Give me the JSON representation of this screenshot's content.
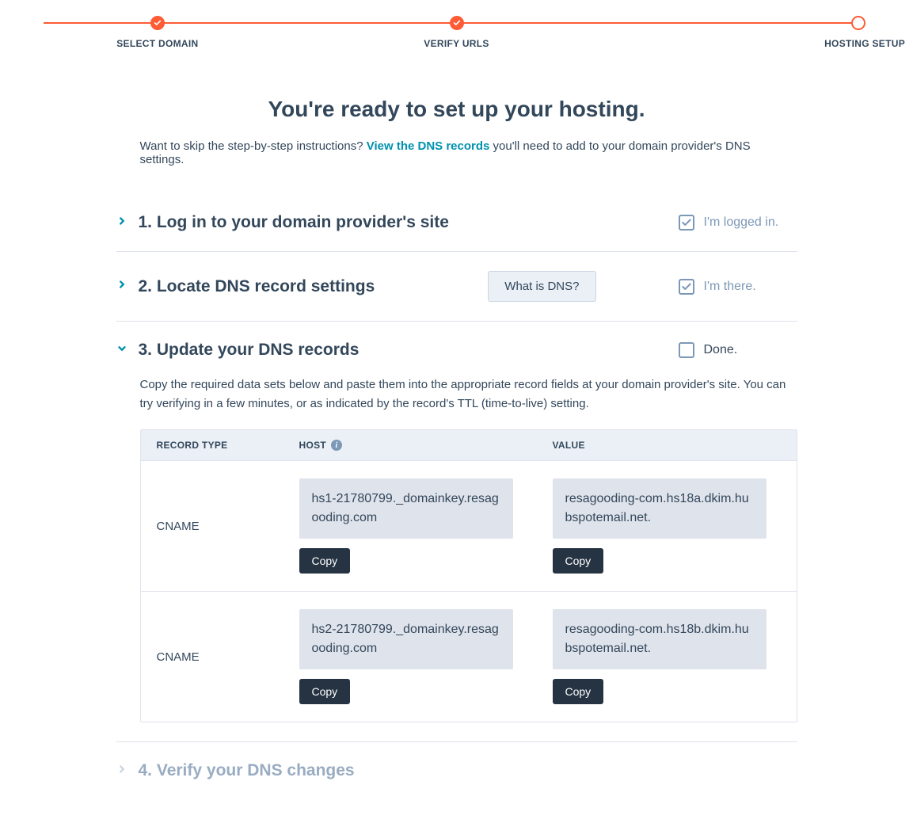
{
  "stepper": {
    "steps": [
      {
        "label": "SELECT DOMAIN",
        "state": "done"
      },
      {
        "label": "VERIFY URLS",
        "state": "done"
      },
      {
        "label": "HOSTING SETUP",
        "state": "pending"
      }
    ]
  },
  "heading": "You're ready to set up your hosting.",
  "skip": {
    "pre": "Want to skip the step-by-step instructions? ",
    "link": "View the DNS records",
    "post": " you'll need to add to your domain provider's DNS settings."
  },
  "steps": [
    {
      "number": "1.",
      "title": "Log in to your domain provider's site",
      "check_label": "I'm logged in.",
      "checked": true
    },
    {
      "number": "2.",
      "title": "Locate DNS record settings",
      "button": "What is DNS?",
      "check_label": "I'm there.",
      "checked": true
    },
    {
      "number": "3.",
      "title": "Update your DNS records",
      "check_label": "Done.",
      "checked": false,
      "desc": "Copy the required data sets below and paste them into the appropriate record fields at your domain provider's site. You can try verifying in a few minutes, or as indicated by the record's TTL (time-to-live) setting."
    },
    {
      "number": "4.",
      "title": "Verify your DNS changes",
      "disabled": true
    }
  ],
  "table": {
    "headers": {
      "type": "RECORD TYPE",
      "host": "HOST",
      "value": "VALUE"
    },
    "copy_label": "Copy",
    "rows": [
      {
        "type": "CNAME",
        "host": "hs1-21780799._domainkey.resagooding.com",
        "value": "resagooding-com.hs18a.dkim.hubspotemail.net."
      },
      {
        "type": "CNAME",
        "host": "hs2-21780799._domainkey.resagooding.com",
        "value": "resagooding-com.hs18b.dkim.hubspotemail.net."
      }
    ]
  }
}
